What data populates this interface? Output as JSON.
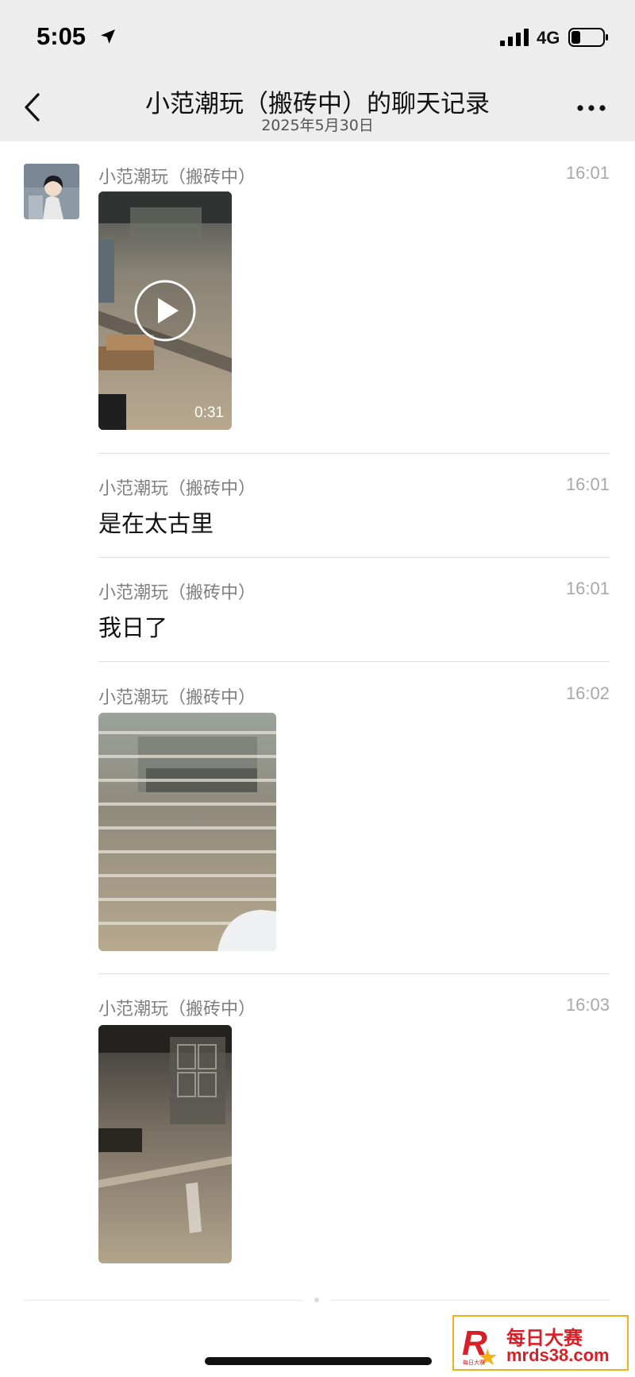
{
  "status_bar": {
    "time": "5:05",
    "network": "4G",
    "battery_level": 0.3,
    "icons": [
      "location-arrow-icon",
      "signal-bars-icon",
      "battery-icon"
    ]
  },
  "header": {
    "title": "小范潮玩（搬砖中）的聊天记录",
    "date": "2025年5月30日",
    "icons": [
      "back-chevron-icon",
      "more-dots-icon"
    ]
  },
  "messages": [
    {
      "sender": "小范潮玩（搬砖中）",
      "time": "16:01",
      "type": "video",
      "duration": "0:31"
    },
    {
      "sender": "小范潮玩（搬砖中）",
      "time": "16:01",
      "type": "text",
      "text": "是在太古里"
    },
    {
      "sender": "小范潮玩（搬砖中）",
      "time": "16:01",
      "type": "text",
      "text": "我日了"
    },
    {
      "sender": "小范潮玩（搬砖中）",
      "time": "16:02",
      "type": "image"
    },
    {
      "sender": "小范潮玩（搬砖中）",
      "time": "16:03",
      "type": "image"
    }
  ],
  "watermark": {
    "name": "每日大赛",
    "url": "mrds38.com",
    "logo_text": "R 每日大赛",
    "accent": "#d81f26"
  }
}
